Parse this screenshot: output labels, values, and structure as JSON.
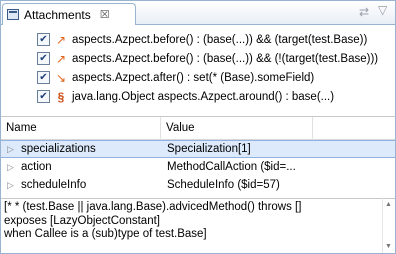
{
  "tab": {
    "label": "Attachments",
    "close": "☒"
  },
  "toolbar": {
    "pin_icon": "⇄",
    "menu_icon": "▽"
  },
  "advices": [
    {
      "checked": true,
      "icon": "before",
      "glyph": "↗",
      "text": "aspects.Azpect.before() : (base(...)) && (target(test.Base))"
    },
    {
      "checked": true,
      "icon": "before",
      "glyph": "↗",
      "text": "aspects.Azpect.before() : (base(...)) && (!(target(test.Base)))"
    },
    {
      "checked": true,
      "icon": "after",
      "glyph": "↘",
      "text": "aspects.Azpect.after() : set(* (Base).someField)"
    },
    {
      "checked": true,
      "icon": "around",
      "glyph": "§",
      "text": "java.lang.Object aspects.Azpect.around() : base(...)"
    }
  ],
  "table": {
    "headers": {
      "name": "Name",
      "value": "Value"
    },
    "rows": [
      {
        "name": "specializations",
        "value": "Specialization[1]",
        "selected": true
      },
      {
        "name": "action",
        "value": "MethodCallAction ($id=...",
        "selected": false
      },
      {
        "name": "scheduleInfo",
        "value": "ScheduleInfo ($id=57)",
        "selected": false
      }
    ]
  },
  "details": {
    "lines": [
      "[* * (test.Base || java.lang.Base).advicedMethod() throws []",
      "exposes [LazyObjectConstant]",
      "when Callee is a (sub)type of test.Base]"
    ]
  },
  "colors": {
    "accent_border": "#99b4d1",
    "selection": "#dceafb",
    "advice_icon": "#e0641b"
  }
}
